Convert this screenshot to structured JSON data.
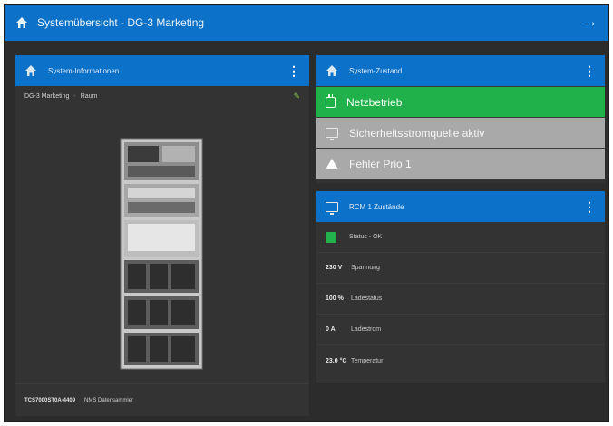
{
  "topbar": {
    "title": "Systemübersicht - DG-3 Marketing",
    "arrow_icon": "arrow-right-icon"
  },
  "left_panel": {
    "header": "System-Informationen",
    "location": "DG-3 Marketing",
    "room": "Raum",
    "footer_serial": "TCS7000ST0A-4409",
    "footer_label": "NMS Datensammler"
  },
  "status_panel": {
    "header": "System-Zustand",
    "rows": [
      {
        "label": "Netzbetrieb",
        "icon": "plug-icon",
        "color": "#21b14a"
      },
      {
        "label": "Sicherheitsstromquelle aktiv",
        "icon": "monitor-icon",
        "color": "#a9a9a9"
      },
      {
        "label": "Fehler Prio 1",
        "icon": "warning-icon",
        "color": "#a9a9a9"
      }
    ]
  },
  "rcm_panel": {
    "header": "RCM 1 Zustände",
    "status_text": "Status - OK",
    "rows": [
      {
        "value": "230 V",
        "label": "Spannung"
      },
      {
        "value": "100 %",
        "label": "Ladestatus"
      },
      {
        "value": "0 A",
        "label": "Ladestrom"
      },
      {
        "value": "23.0 °C",
        "label": "Temperatur"
      }
    ]
  },
  "colors": {
    "accent": "#0b71c9",
    "background": "#2c2c2c",
    "ok": "#21b14a"
  }
}
